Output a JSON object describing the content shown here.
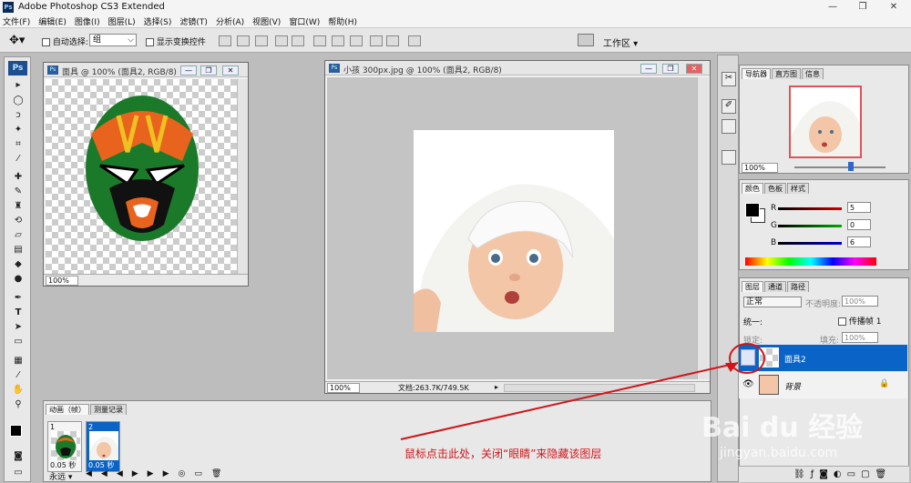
{
  "app": {
    "title": "Adobe Photoshop CS3 Extended",
    "logo": "Ps"
  },
  "window_controls": {
    "minimize": "—",
    "restore": "❐",
    "close": "✕"
  },
  "menu": [
    "文件(F)",
    "编辑(E)",
    "图像(I)",
    "图层(L)",
    "选择(S)",
    "滤镜(T)",
    "分析(A)",
    "视图(V)",
    "窗口(W)",
    "帮助(H)"
  ],
  "options": {
    "auto_select_label": "自动选择:",
    "auto_select_value": "组",
    "show_transform_label": "显示变换控件",
    "workspace_label": "工作区"
  },
  "doc1": {
    "title": "面具 @ 100% (面具2, RGB/8)",
    "zoom": "100%"
  },
  "doc2": {
    "title": "小孩 300px.jpg @ 100% (面具2, RGB/8)",
    "zoom": "100%",
    "doc_size": "文档:263.7K/749.5K"
  },
  "navigator": {
    "tabs": [
      "导航器",
      "直方图",
      "信息"
    ],
    "zoom": "100%"
  },
  "color_panel": {
    "tabs": [
      "颜色",
      "色板",
      "样式"
    ],
    "r_label": "R",
    "g_label": "G",
    "b_label": "B",
    "r": "5",
    "g": "0",
    "b": "6"
  },
  "layers_panel": {
    "tabs": [
      "图层",
      "通道",
      "路径"
    ],
    "blend_mode": "正常",
    "opacity_label": "不透明度:",
    "opacity": "100%",
    "unify_label": "统一:",
    "propagate_label": "传播帧 1",
    "lock_label": "锁定:",
    "fill_label": "填充:",
    "fill": "100%",
    "layers": [
      {
        "name": "面具2",
        "selected": true
      },
      {
        "name": "背景",
        "selected": false
      }
    ]
  },
  "animation": {
    "tabs": [
      "动画（帧）",
      "测量记录"
    ],
    "frames": [
      {
        "num": "1",
        "delay": "0.05 秒"
      },
      {
        "num": "2",
        "delay": "0.05 秒"
      }
    ],
    "loop": "永远"
  },
  "annotation": "鼠标点击此处，关闭“眼睛”来隐藏该图层",
  "watermark": {
    "brand": "Bai du 经验",
    "url": "jingyan.baidu.com"
  },
  "colors": {
    "accent": "#0a64c8",
    "annotation": "#d0161a",
    "mask_green": "#1a7a2a",
    "mask_orange": "#e8641e",
    "mask_yellow": "#f0c020"
  }
}
